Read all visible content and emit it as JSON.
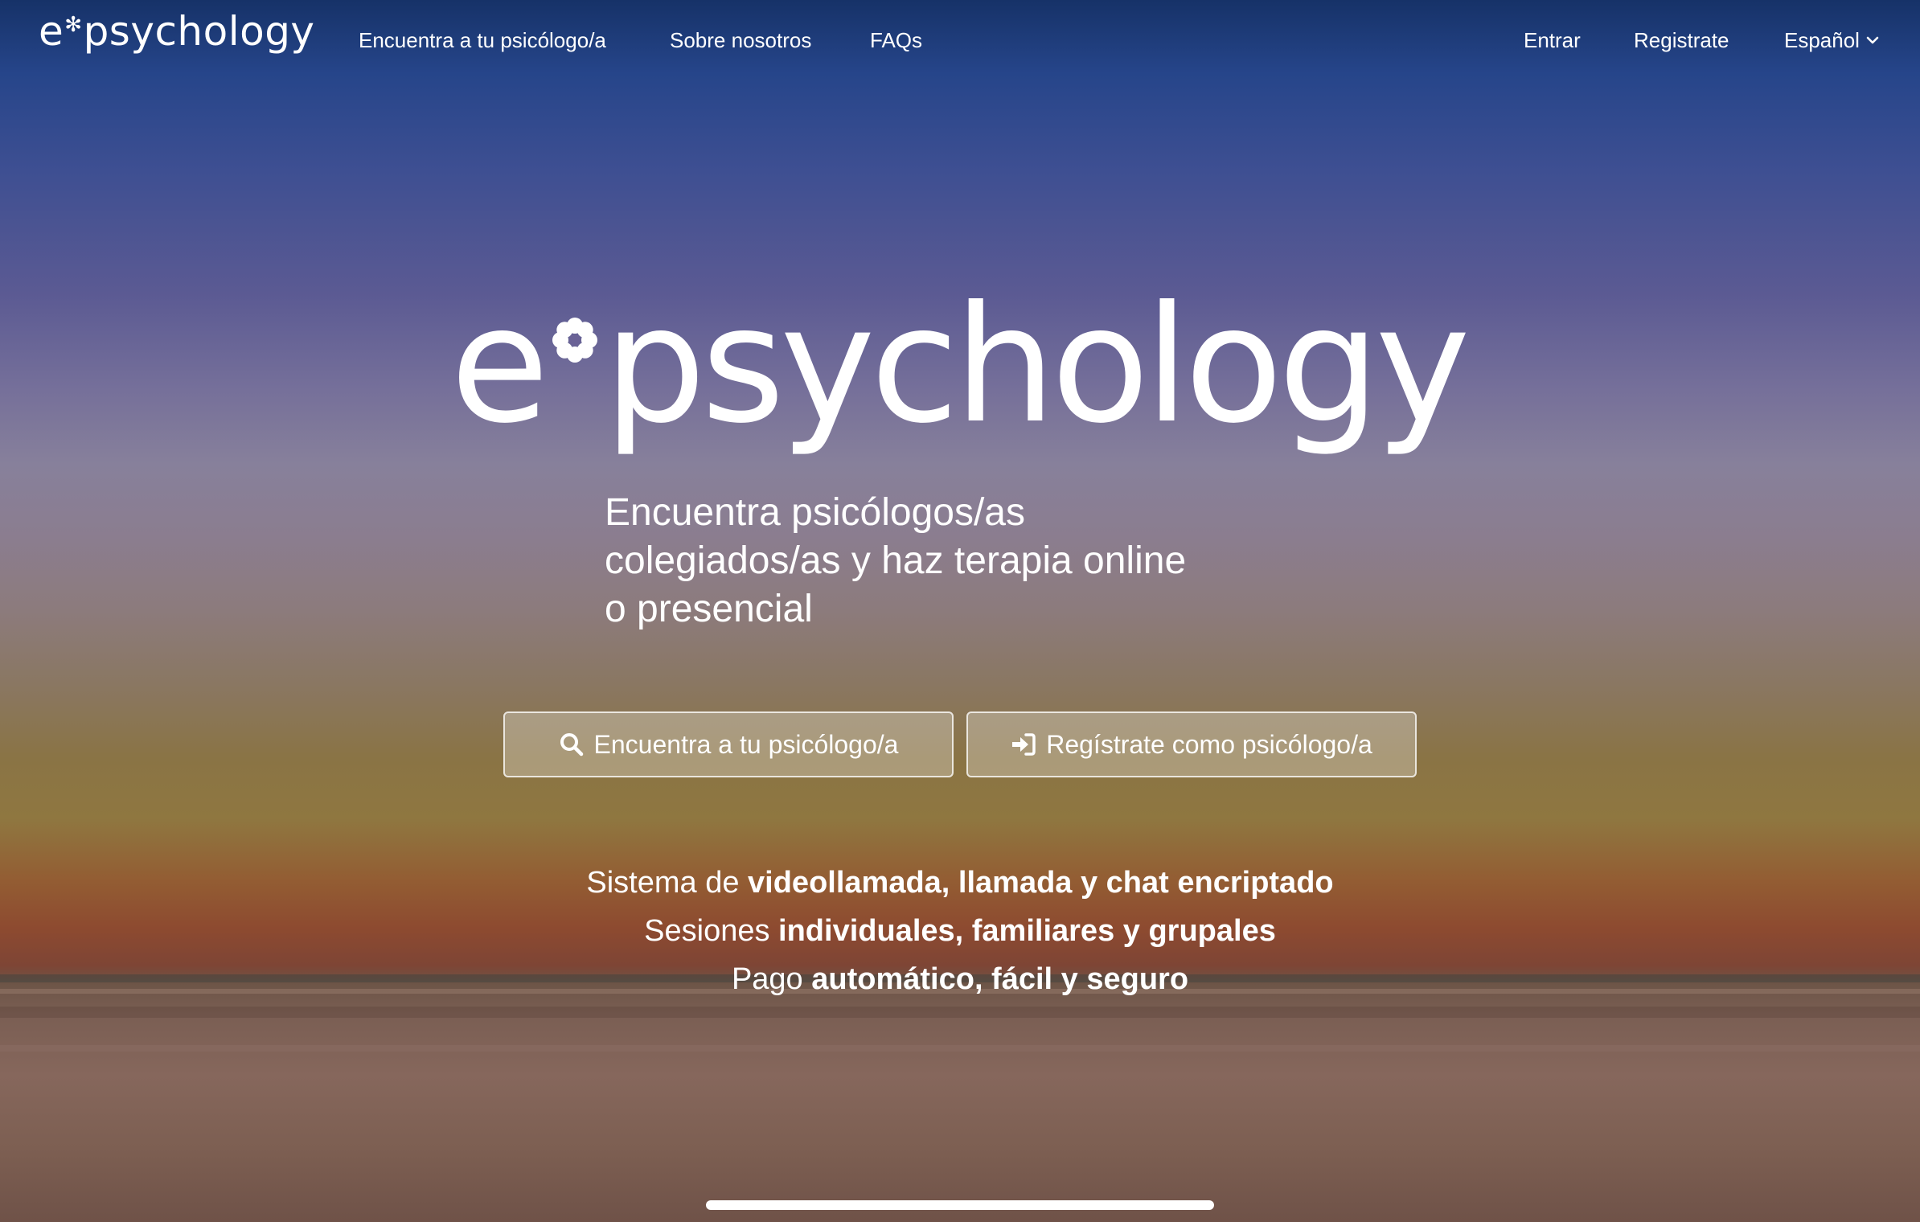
{
  "header": {
    "brand_prefix": "e",
    "brand_suffix": "psychology",
    "brand_mark_icon": "asterisk-flower-icon",
    "nav": {
      "find": "Encuentra a tu psicólogo/a",
      "about": "Sobre nosotros",
      "faqs": "FAQs",
      "login": "Entrar",
      "register": "Registrate",
      "language": "Español"
    }
  },
  "hero": {
    "logo_prefix": "e",
    "logo_suffix": "psychology",
    "tagline_lines": [
      "Encuentra psicólogos/as",
      "colegiados/as y haz terapia online",
      "o presencial"
    ],
    "buttons": {
      "find": "Encuentra a tu psicólogo/a",
      "find_icon": "search-icon",
      "register": "Regístrate como psicólogo/a",
      "register_icon": "sign-in-icon"
    },
    "features": [
      {
        "light": "Sistema de ",
        "bold": "videollamada, llamada y chat encriptado"
      },
      {
        "light": "Sesiones ",
        "bold": "individuales, familiares y grupales"
      },
      {
        "light": "Pago ",
        "bold": "automático, fácil y seguro"
      }
    ]
  },
  "colors": {
    "text": "#ffffff",
    "button_fill": "rgba(255,255,255,0.28)",
    "button_border": "rgba(255,255,255,0.75)"
  }
}
